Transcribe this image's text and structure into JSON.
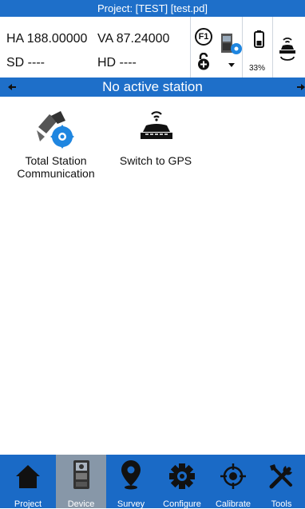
{
  "title": "Project: [TEST] [test.pd]",
  "measurements": {
    "ha": "HA 188.00000",
    "va": "VA 87.24000",
    "sd": "SD ----",
    "hd": "HD ----"
  },
  "status_icons": {
    "f1_label": "F1",
    "battery_percent": "33%"
  },
  "station_bar": {
    "text": "No active station"
  },
  "apps": [
    {
      "label_line1": "Total Station",
      "label_line2": "Communication",
      "icon": "total-station-settings-icon"
    },
    {
      "label_line1": "Switch to GPS",
      "label_line2": "",
      "icon": "gps-receiver-icon"
    }
  ],
  "nav": {
    "items": [
      {
        "label": "Project",
        "icon": "house-icon"
      },
      {
        "label": "Device",
        "icon": "device-icon",
        "active": true
      },
      {
        "label": "Survey",
        "icon": "map-pin-icon"
      },
      {
        "label": "Configure",
        "icon": "gear-icon"
      },
      {
        "label": "Calibrate",
        "icon": "crosshair-icon"
      },
      {
        "label": "Tools",
        "icon": "tools-icon"
      }
    ]
  },
  "colors": {
    "primary_blue": "#1e6fc9",
    "active_nav": "#8797a8",
    "accent_blue": "#1f86e0"
  }
}
